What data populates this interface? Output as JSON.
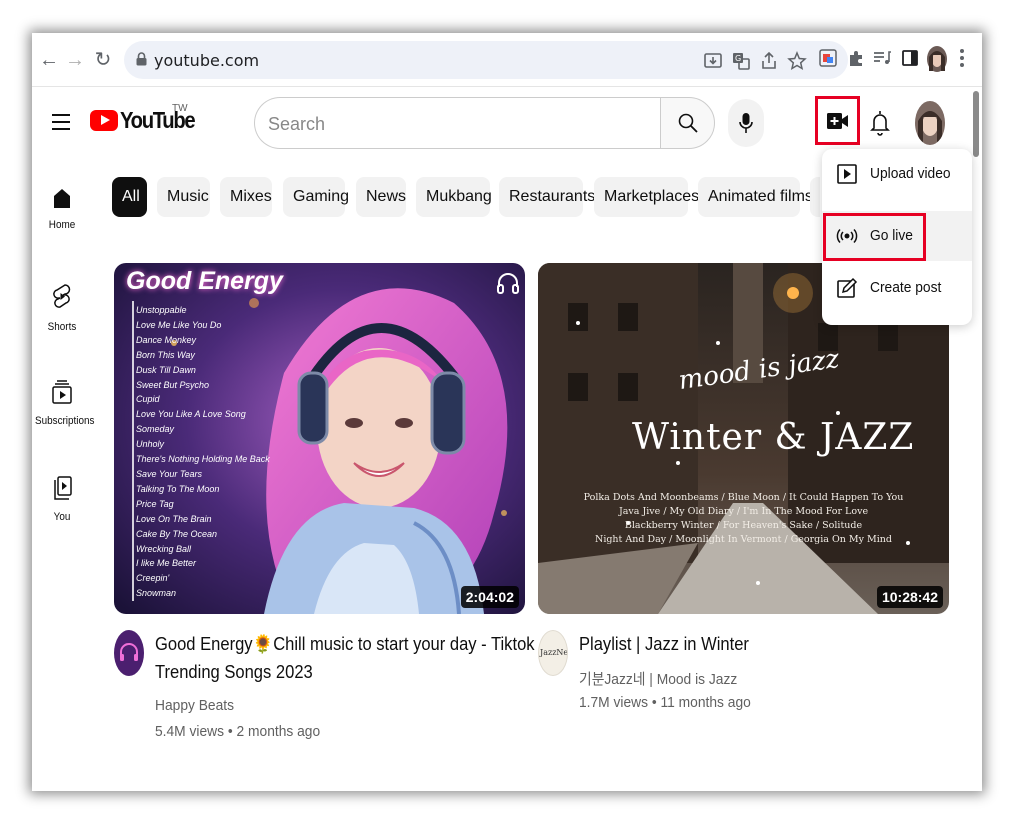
{
  "browser": {
    "url": "youtube.com"
  },
  "header": {
    "logo_text": "YouTube",
    "region": "TW",
    "search_placeholder": "Search"
  },
  "nav": {
    "items": [
      {
        "label": "Home",
        "icon": "home-icon"
      },
      {
        "label": "Shorts",
        "icon": "shorts-icon"
      },
      {
        "label": "Subscriptions",
        "icon": "subscriptions-icon"
      },
      {
        "label": "You",
        "icon": "you-icon"
      }
    ]
  },
  "chips": [
    "All",
    "Music",
    "Mixes",
    "Gaming",
    "News",
    "Mukbang",
    "Restaurants",
    "Marketplaces",
    "Animated films"
  ],
  "create_menu": {
    "items": [
      {
        "label": "Upload video",
        "icon": "upload-video-icon"
      },
      {
        "label": "Go live",
        "icon": "go-live-icon"
      },
      {
        "label": "Create post",
        "icon": "create-post-icon"
      }
    ]
  },
  "videos": [
    {
      "title_line1": "Good Energy🌻Chill music to start your day - Tiktok",
      "title_line2": "Trending Songs 2023",
      "channel": "Happy Beats",
      "stats": "5.4M views • 2 months ago",
      "duration": "2:04:02",
      "thumb_heading": "Good Energy",
      "thumb_songs": [
        "Unstoppable",
        "Love Me Like You Do",
        "Dance Monkey",
        "Born This Way",
        "Dusk Till Dawn",
        "Sweet But Psycho",
        "Cupid",
        "Love You Like A Love Song",
        "Someday",
        "Unholy",
        "There's Nothing Holding Me Back",
        "Save Your Tears",
        "Talking To The Moon",
        "Price Tag",
        "Love On The Brain",
        "Cake By The Ocean",
        "Wrecking Ball",
        "I like Me Better",
        "Creepin'",
        "Snowman"
      ]
    },
    {
      "title_line1": "Playlist | Jazz in Winter",
      "channel": "기분Jazz네 | Mood is Jazz",
      "stats": "1.7M views • 11 months ago",
      "duration": "10:28:42",
      "avatar_text": "JazzNe",
      "thumb_script": "mood is jazz",
      "thumb_heading": "Winter & JAZZ",
      "thumb_lines": [
        "Polka Dots And Moonbeams / Blue Moon / It Could Happen To You",
        "Java Jive / My Old Diary / I'm In The Mood For Love",
        "Blackberry Winter / For Heaven's Sake / Solitude",
        "Night And Day / Moonlight In Vermont / Georgia On My Mind"
      ]
    }
  ]
}
